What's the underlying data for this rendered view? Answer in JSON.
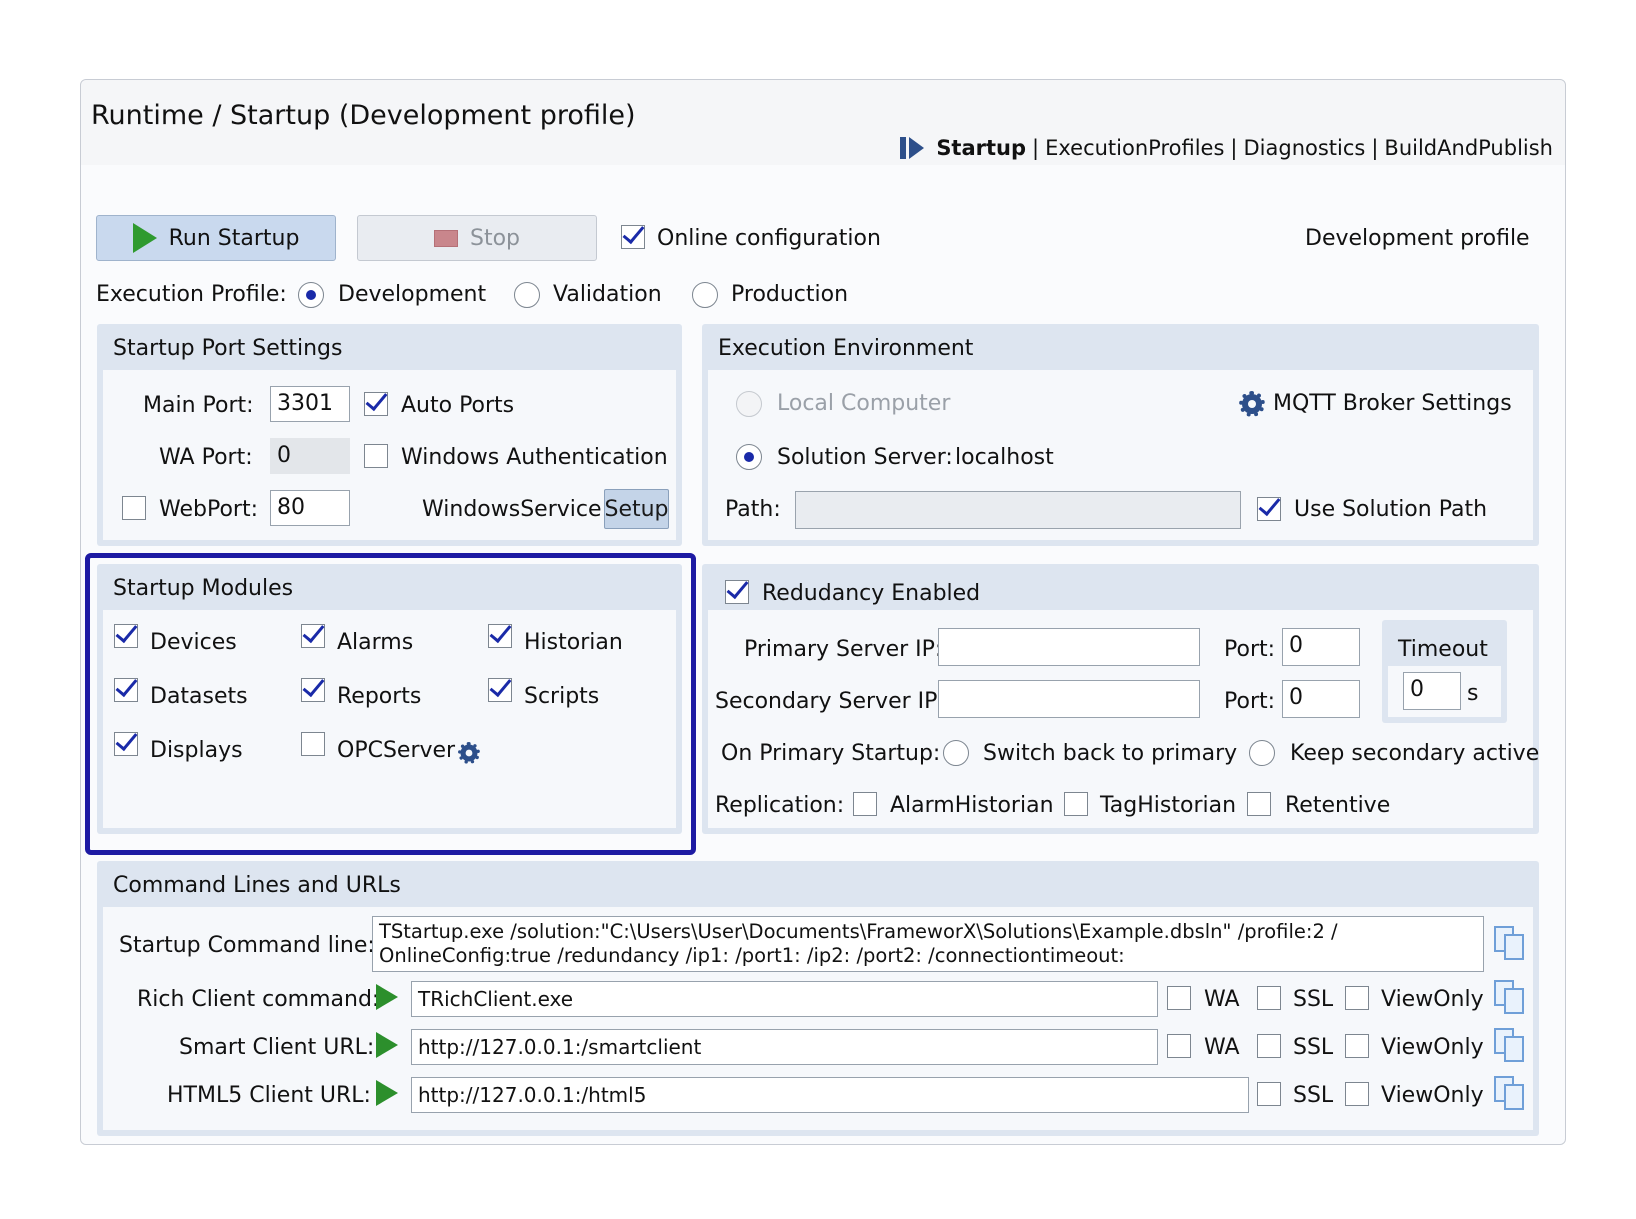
{
  "header": {
    "title": "Runtime / Startup (Development profile)",
    "breadcrumb": [
      "Startup",
      "ExecutionProfiles",
      "Diagnostics",
      "BuildAndPublish"
    ],
    "separator": "|"
  },
  "toolbar": {
    "run_label": "Run Startup",
    "stop_label": "Stop",
    "online_config_label": "Online configuration",
    "online_config_checked": true,
    "profile_status": "Development profile"
  },
  "execution_profile": {
    "label": "Execution Profile:",
    "options": [
      "Development",
      "Validation",
      "Production"
    ],
    "selected": "Development"
  },
  "port_settings": {
    "title": "Startup Port Settings",
    "main_port_label": "Main Port:",
    "main_port_value": "3301",
    "auto_ports_label": "Auto Ports",
    "auto_ports_checked": true,
    "wa_port_label": "WA Port:",
    "wa_port_value": "0",
    "windows_auth_label": "Windows Authentication",
    "windows_auth_checked": false,
    "webport_label": "WebPort:",
    "webport_checked": false,
    "webport_value": "80",
    "windows_service_label": "WindowsService",
    "setup_label": "Setup"
  },
  "execution_environment": {
    "title": "Execution Environment",
    "local_label": "Local Computer",
    "mqtt_label": "MQTT Broker Settings",
    "solution_server_label": "Solution Server:",
    "solution_server_value": "localhost",
    "path_label": "Path:",
    "path_value": "",
    "use_solution_path_label": "Use Solution Path",
    "use_solution_path_checked": true
  },
  "startup_modules": {
    "title": "Startup Modules",
    "items": [
      {
        "label": "Devices",
        "checked": true
      },
      {
        "label": "Alarms",
        "checked": true
      },
      {
        "label": "Historian",
        "checked": true
      },
      {
        "label": "Datasets",
        "checked": true
      },
      {
        "label": "Reports",
        "checked": true
      },
      {
        "label": "Scripts",
        "checked": true
      },
      {
        "label": "Displays",
        "checked": true
      },
      {
        "label": "OPCServer",
        "checked": false
      }
    ]
  },
  "redundancy": {
    "title": "Redudancy Enabled",
    "enabled": true,
    "primary_ip_label": "Primary Server IP:",
    "primary_ip_value": "",
    "secondary_ip_label": "Secondary Server IP:",
    "secondary_ip_value": "",
    "port_label": "Port:",
    "primary_port_value": "0",
    "secondary_port_value": "0",
    "timeout_label": "Timeout",
    "timeout_value": "0",
    "timeout_unit": "s",
    "on_primary_label": "On Primary Startup:",
    "switch_back_label": "Switch back to primary",
    "keep_secondary_label": "Keep secondary active",
    "replication_label": "Replication:",
    "replication_items": [
      "AlarmHistorian",
      "TagHistorian",
      "Retentive"
    ]
  },
  "command_lines": {
    "title": "Command Lines and URLs",
    "startup_label": "Startup Command line:",
    "startup_line1": "TStartup.exe /solution:\"C:\\Users\\User\\Documents\\FrameworX\\Solutions\\Example.dbsln\" /profile:2 /",
    "startup_line2": "OnlineConfig:true /redundancy /ip1: /port1: /ip2: /port2: /connectiontimeout:",
    "rich_label": "Rich Client command:",
    "rich_value": "TRichClient.exe",
    "smart_label": "Smart Client URL:",
    "smart_value": "http://127.0.0.1:/smartclient",
    "html5_label": "HTML5 Client URL:",
    "html5_value": "http://127.0.0.1:/html5",
    "wa_label": "WA",
    "ssl_label": "SSL",
    "viewonly_label": "ViewOnly"
  },
  "colors": {
    "highlight_border": "#1d1aa3",
    "panel_bg": "#dde5f0",
    "button_bg": "#c9d9ee",
    "check_color": "#1a2aa8"
  }
}
